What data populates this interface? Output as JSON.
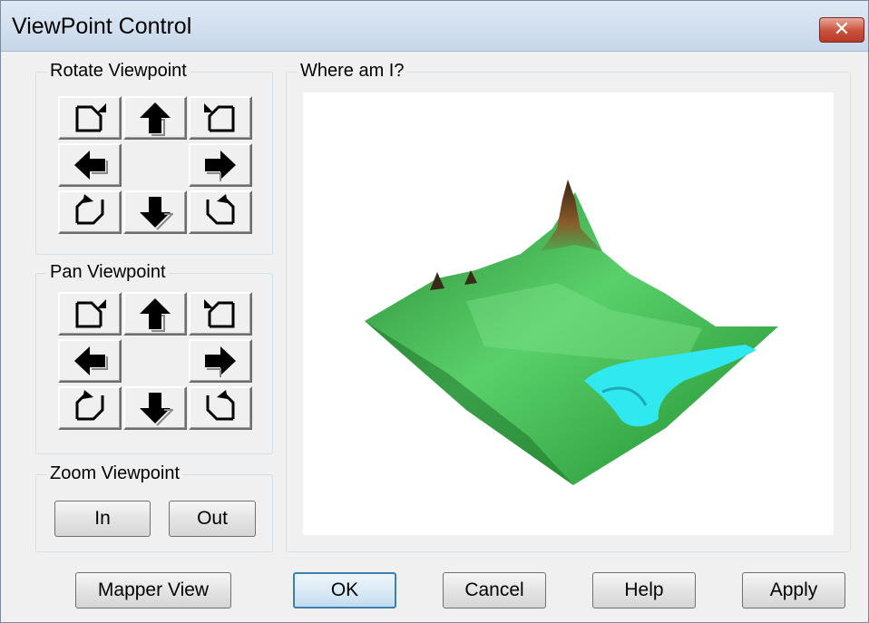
{
  "window": {
    "title": "ViewPoint Control",
    "close_glyph": "✕"
  },
  "rotate_group": {
    "label": "Rotate Viewpoint"
  },
  "pan_group": {
    "label": "Pan Viewpoint"
  },
  "zoom_group": {
    "label": "Zoom Viewpoint",
    "in_label": "In",
    "out_label": "Out"
  },
  "where_group": {
    "label": "Where am I?"
  },
  "footer": {
    "mapper_view_label": "Mapper View",
    "ok_label": "OK",
    "cancel_label": "Cancel",
    "help_label": "Help",
    "apply_label": "Apply"
  },
  "arrow_buttons": [
    "rotate-ccw-up-icon",
    "arrow-up-icon",
    "rotate-cw-up-icon",
    "arrow-left-icon",
    "arrow-right-icon",
    "rotate-ccw-down-icon",
    "arrow-down-icon",
    "rotate-cw-down-icon"
  ],
  "colors": {
    "terrain_green": "#3fbf4a",
    "water_cyan": "#2fe8f0",
    "peak_brown": "#5a3a20"
  }
}
